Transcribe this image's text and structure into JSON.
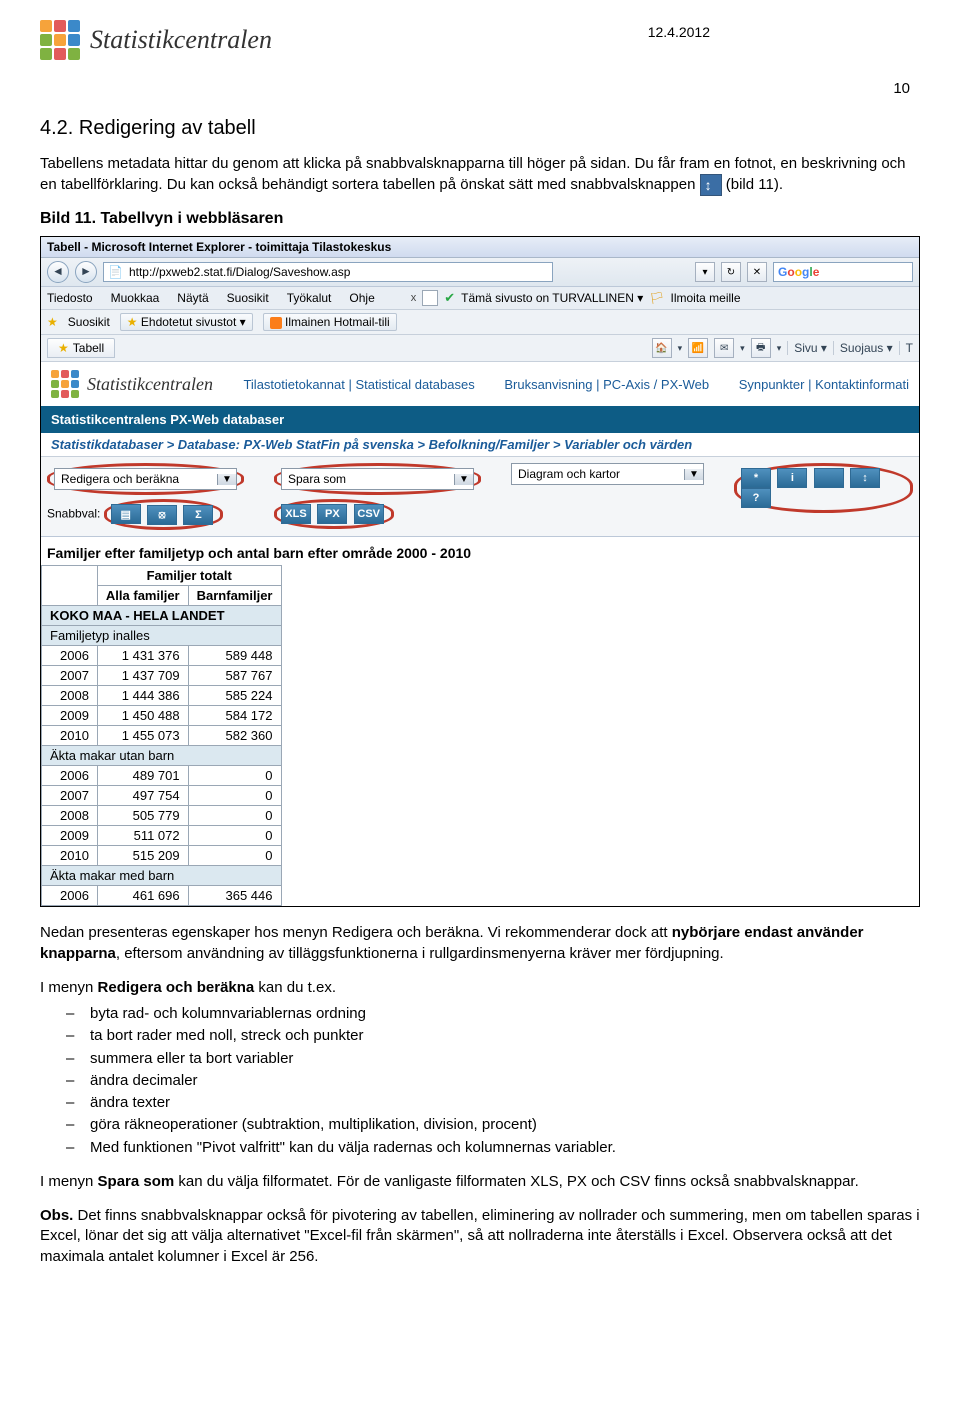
{
  "header": {
    "brand_name": "Statistikcentralen",
    "date": "12.4.2012",
    "page_number": "10"
  },
  "section": {
    "title": "4.2. Redigering av tabell",
    "intro": "Tabellens metadata hittar du genom att klicka på snabbvalsknapparna till höger på sidan. Du får fram en fotnot, en beskrivning och en tabellförklaring. Du kan också behändigt sortera tabellen på önskat sätt med snabbvalsknappen",
    "intro_tail": " (bild 11).",
    "caption": "Bild 11. Tabellvyn i webbläsaren"
  },
  "screenshot": {
    "ie_title": "Tabell - Microsoft Internet Explorer - toimittaja Tilastokeskus",
    "url": "http://pxweb2.stat.fi/Dialog/Saveshow.asp",
    "google": "Google",
    "menu": [
      "Tiedosto",
      "Muokkaa",
      "Näytä",
      "Suosikit",
      "Työkalut",
      "Ohje"
    ],
    "safe_text": "Tämä sivusto on TURVALLINEN ▾",
    "report": "Ilmoita meille",
    "fav_row": {
      "suosikit": "Suosikit",
      "ehdo": "Ehdotetut sivustot ▾",
      "hotmail": "Ilmainen Hotmail-tili"
    },
    "tab": "Tabell",
    "tabbar_right": [
      "Sivu ▾",
      "Suojaus ▾",
      "T"
    ],
    "nav_links": {
      "grp1": [
        "Tilastotietokannat",
        "Statistical databases"
      ],
      "grp2": [
        "Bruksanvisning",
        "PC-Axis / PX-Web"
      ],
      "grp3": [
        "Synpunkter",
        "Kontaktinformati"
      ]
    },
    "blue_strip": "Statistikcentralens PX-Web databaser",
    "breadcrumb": "Statistikdatabaser > Database: PX-Web StatFin på svenska > Befolkning/Familjer > Variabler och värden",
    "toolbar": {
      "redigera": "Redigera och beräkna",
      "snabbval_label": "Snabbval:",
      "spara": "Spara som",
      "xls": "XLS",
      "px": "PX",
      "csv": "CSV",
      "diagram": "Diagram och kartor"
    },
    "table": {
      "title": "Familjer efter familjetyp och antal barn efter område 2000 - 2010",
      "h_parent": "Familjer totalt",
      "h1": "Alla familjer",
      "h2": "Barnfamiljer",
      "rows": [
        {
          "label": "KOKO MAA - HELA LANDET",
          "head": true
        },
        {
          "label": "Familjetyp inalles",
          "sub": true
        },
        {
          "label": "2006",
          "v1": "1 431 376",
          "v2": "589 448"
        },
        {
          "label": "2007",
          "v1": "1 437 709",
          "v2": "587 767"
        },
        {
          "label": "2008",
          "v1": "1 444 386",
          "v2": "585 224"
        },
        {
          "label": "2009",
          "v1": "1 450 488",
          "v2": "584 172"
        },
        {
          "label": "2010",
          "v1": "1 455 073",
          "v2": "582 360"
        },
        {
          "label": "Äkta makar utan barn",
          "sub": true
        },
        {
          "label": "2006",
          "v1": "489 701",
          "v2": "0"
        },
        {
          "label": "2007",
          "v1": "497 754",
          "v2": "0"
        },
        {
          "label": "2008",
          "v1": "505 779",
          "v2": "0"
        },
        {
          "label": "2009",
          "v1": "511 072",
          "v2": "0"
        },
        {
          "label": "2010",
          "v1": "515 209",
          "v2": "0"
        },
        {
          "label": "Äkta makar med barn",
          "sub": true
        },
        {
          "label": "2006",
          "v1": "461 696",
          "v2": "365 446"
        }
      ]
    }
  },
  "body": {
    "para_after_1": "Nedan presenteras egenskaper hos menyn Redigera och beräkna. Vi rekommenderar dock att ",
    "para_after_1b": "nybörjare endast använder knapparna",
    "para_after_1c": ", eftersom användning av tilläggsfunktionerna i rullgardinsmenyerna kräver mer fördjupning.",
    "redigera_intro_a": "I menyn ",
    "redigera_intro_b": "Redigera och beräkna",
    "redigera_intro_c": " kan du t.ex.",
    "bullets": [
      "byta rad- och kolumnvariablernas ordning",
      "ta bort rader med noll, streck och punkter",
      "summera eller ta bort variabler",
      "ändra decimaler",
      "ändra texter",
      "göra räkneoperationer (subtraktion, multiplikation, division, procent)",
      "Med funktionen \"Pivot valfritt\" kan du välja radernas och kolumnernas variabler."
    ],
    "spara_a": "I menyn ",
    "spara_b": "Spara som",
    "spara_c": " kan du välja filformatet. För de vanligaste filformaten XLS, PX och CSV finns också snabbvalsknappar.",
    "obs_a": "Obs.",
    "obs_b": " Det finns snabbvalsknappar också för pivotering av tabellen, eliminering av nollrader och summering, men om tabellen sparas i Excel, lönar det sig att välja alternativet \"Excel-fil från skärmen\", så att nollraderna inte återställs i Excel. Observera också att det maximala antalet kolumner i Excel är 256."
  }
}
